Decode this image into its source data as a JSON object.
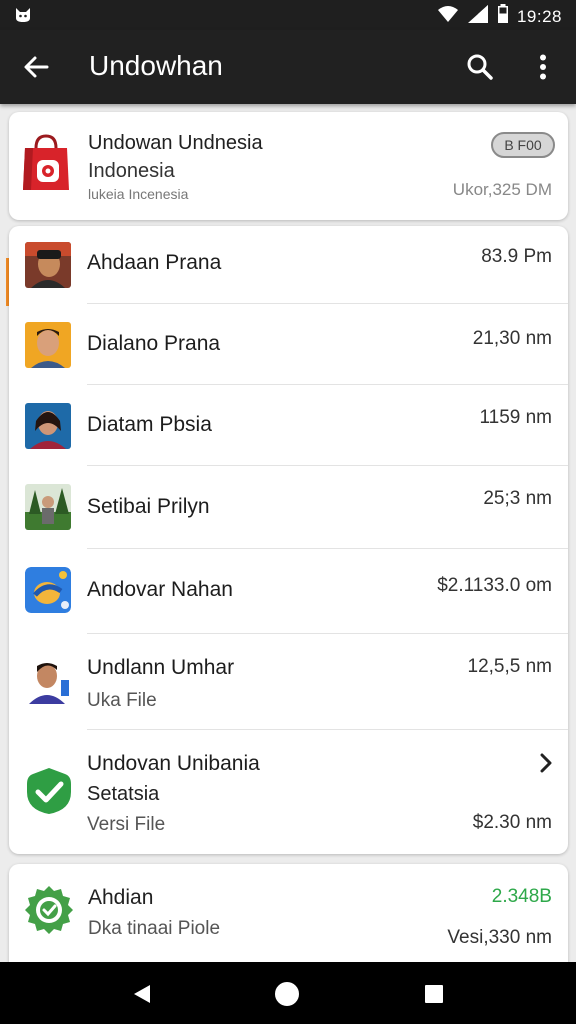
{
  "status_bar": {
    "time": "19:28",
    "icons": [
      "cat-app-icon",
      "wifi-icon",
      "signal-icon",
      "battery-icon"
    ]
  },
  "app_bar": {
    "title": "Undowhan",
    "icons": [
      "back-arrow-icon",
      "search-icon",
      "more-vert-icon"
    ]
  },
  "header_card": {
    "title": "Undowan Undnesia",
    "subtitle": "Indonesia",
    "small_text": "lukeia Incenesia",
    "badge": "B F00",
    "amount": "Ukor,325 DM",
    "icon": "shopping-bag-icon"
  },
  "list": [
    {
      "name": "Ahdaan Prana",
      "amount": "83.9 Pm"
    },
    {
      "name": "Dialano Prana",
      "amount": "21,30 nm"
    },
    {
      "name": "Diatam Pbsia",
      "amount": "1159 nm"
    },
    {
      "name": "Setibai Prilyn",
      "amount": "25;3 nm"
    },
    {
      "name": "Andovar Nahan",
      "amount": "$2.1133.0 om"
    },
    {
      "name": "Undlann Umhar",
      "subtitle": "Uka File",
      "amount": "12,5,5 nm"
    },
    {
      "name": "Undovan Unibania",
      "subtitle": "Setatsia",
      "subtitle2": "Versi File",
      "amount": "$2.30 nm"
    }
  ],
  "bottom_card": {
    "name": "Ahdian",
    "subtitle": "Dka tinaai Piole",
    "green_value": "2.348B",
    "amount": "Vesi,330 nm"
  },
  "colors": {
    "app_bar": "#212121",
    "accent_orange": "#f08a24",
    "green": "#2ea84a",
    "bag_red": "#d8232a"
  },
  "nav_bar": {
    "icons": [
      "back-triangle-icon",
      "home-circle-icon",
      "recents-square-icon"
    ]
  }
}
